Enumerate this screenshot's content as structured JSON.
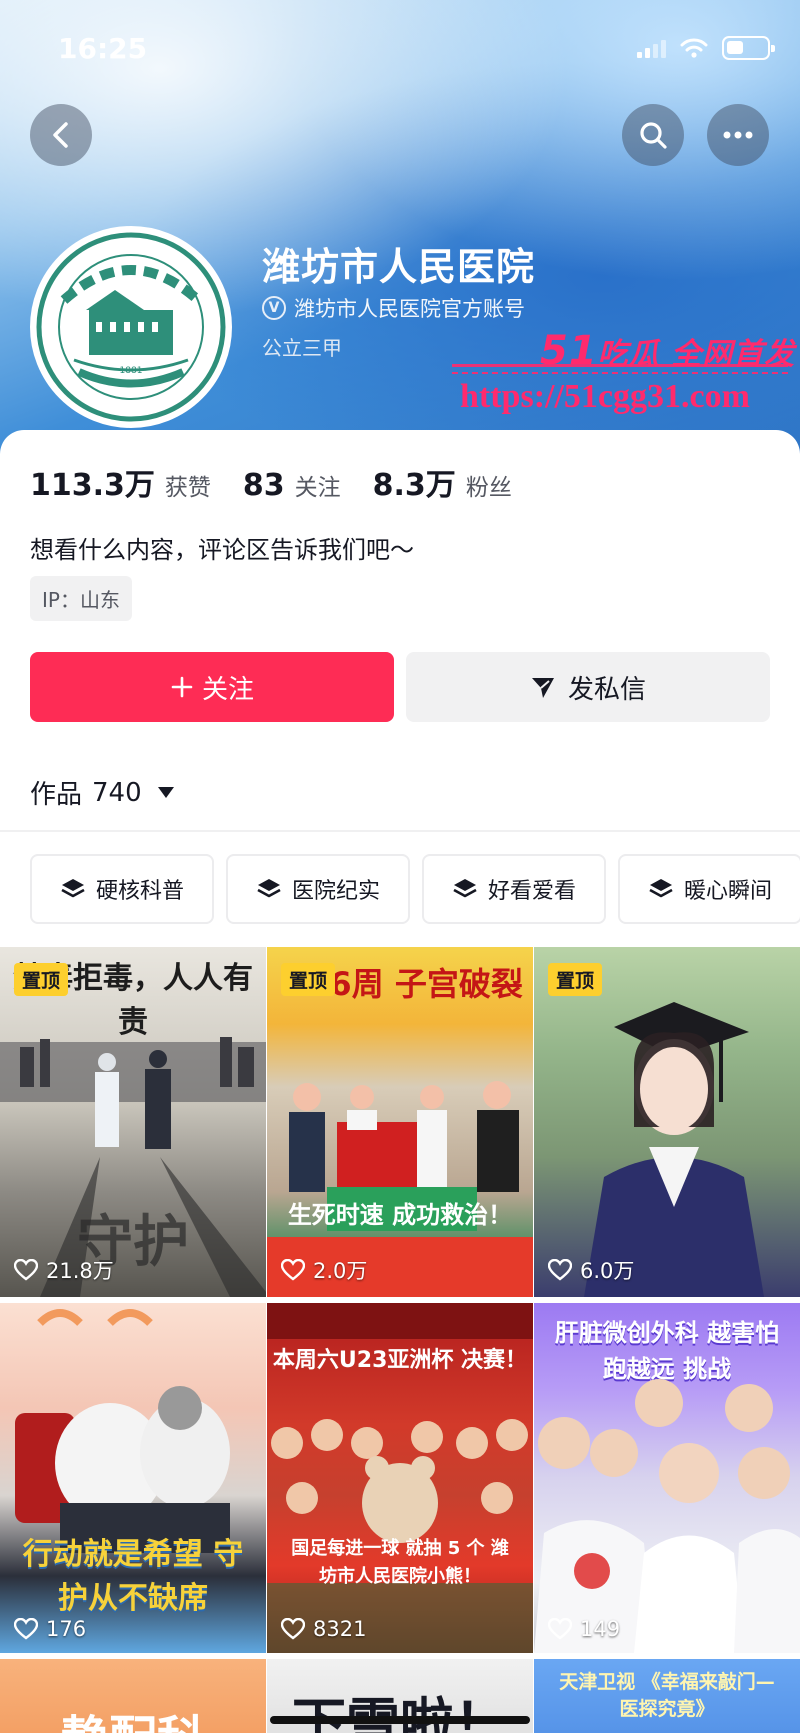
{
  "status_bar": {
    "time": "16:25"
  },
  "profile": {
    "name": "潍坊市人民医院",
    "verified_label": "潍坊市人民医院官方账号",
    "tag": "公立三甲",
    "logo_text": "潍坊市人民医院 · 1881 · WEIFANG PEOPLE'S HOSPITAL"
  },
  "watermark": {
    "line1_num": "51",
    "line1_text": "吃瓜 全网首发",
    "line2": "https://51cgg31.com"
  },
  "stats": [
    {
      "num": "113.3万",
      "label": "获赞"
    },
    {
      "num": "83",
      "label": "关注"
    },
    {
      "num": "8.3万",
      "label": "粉丝"
    }
  ],
  "bio": "想看什么内容，评论区告诉我们吧～",
  "ip": "IP：山东",
  "actions": {
    "follow": "关注",
    "message": "发私信"
  },
  "works": {
    "label": "作品",
    "count": "740"
  },
  "collections": [
    "硬核科普",
    "医院纪实",
    "好看爱看",
    "暖心瞬间"
  ],
  "pinned_label": "置顶",
  "videos": [
    {
      "title_top": "禁毒拒毒，人人有责",
      "title_bottom": "守护",
      "likes": "21.8万",
      "pinned": true
    },
    {
      "title_top": "16周 子宫破裂",
      "title_bottom": "生死时速 成功救治！",
      "likes": "2.0万",
      "pinned": true
    },
    {
      "title_top": "",
      "title_bottom": "",
      "likes": "6.0万",
      "pinned": true
    },
    {
      "title_top": "",
      "title_bottom": "行动就是希望 守护从不缺席",
      "likes": "176",
      "pinned": false
    },
    {
      "title_top": "本周六U23亚洲杯 决赛！",
      "title_bottom": "国足每进一球 就抽 5 个 潍坊市人民医院小熊！",
      "likes": "8321",
      "pinned": false
    },
    {
      "title_top": "肝脏微创外科 越害怕跑越远 挑战",
      "title_bottom": "",
      "likes": "149",
      "pinned": false
    },
    {
      "title_top": "静配科",
      "likes": ""
    },
    {
      "title_top": "下雪啦！",
      "likes": ""
    },
    {
      "title_top": "天津卫视 《幸福来敲门—医探究竟》",
      "likes": ""
    }
  ]
}
